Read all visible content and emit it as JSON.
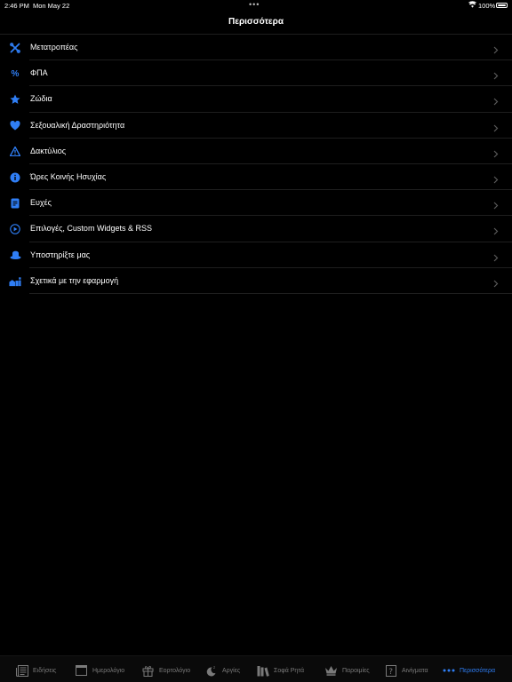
{
  "status": {
    "time": "2:46 PM",
    "date": "Mon May 22",
    "dots": "•••",
    "battery_pct": "100%"
  },
  "nav": {
    "title": "Περισσότερα"
  },
  "menu": [
    {
      "label": "Μετατροπέας",
      "icon": "tools-icon"
    },
    {
      "label": "ΦΠΑ",
      "icon": "percent-icon"
    },
    {
      "label": "Ζώδια",
      "icon": "star-icon"
    },
    {
      "label": "Σεξουαλική Δραστηριότητα",
      "icon": "heart-icon"
    },
    {
      "label": "Δακτύλιος",
      "icon": "warning-icon"
    },
    {
      "label": "Ώρες Κοινής Ησυχίας",
      "icon": "info-icon"
    },
    {
      "label": "Ευχές",
      "icon": "card-icon"
    },
    {
      "label": "Επιλογές, Custom Widgets & RSS",
      "icon": "play-circle-icon"
    },
    {
      "label": "Υποστηρίξτε μας",
      "icon": "hat-icon"
    },
    {
      "label": "Σχετικά με την εφαρμογή",
      "icon": "about-icon"
    }
  ],
  "tabs": [
    {
      "label": "Ειδήσεις",
      "icon": "newspaper-icon",
      "active": false
    },
    {
      "label": "Ημερολόγιο",
      "icon": "calendar-icon",
      "active": false
    },
    {
      "label": "Εορτολόγιο",
      "icon": "gift-icon",
      "active": false
    },
    {
      "label": "Αργίες",
      "icon": "moon-icon",
      "active": false
    },
    {
      "label": "Σοφά Ρητά",
      "icon": "books-icon",
      "active": false
    },
    {
      "label": "Παροιμίες",
      "icon": "crown-icon",
      "active": false
    },
    {
      "label": "Αινίγματα",
      "icon": "question-icon",
      "active": false
    },
    {
      "label": "Περισσότερα",
      "icon": "more-icon",
      "active": true
    }
  ],
  "colors": {
    "accent": "#2f7ef5",
    "background": "#000000",
    "inactive": "#7a7a7a"
  }
}
